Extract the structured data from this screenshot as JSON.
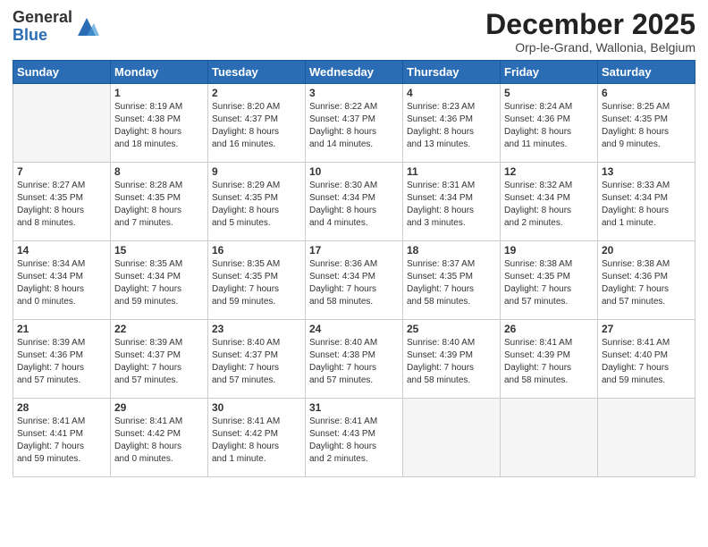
{
  "logo": {
    "general": "General",
    "blue": "Blue"
  },
  "header": {
    "title": "December 2025",
    "subtitle": "Orp-le-Grand, Wallonia, Belgium"
  },
  "weekdays": [
    "Sunday",
    "Monday",
    "Tuesday",
    "Wednesday",
    "Thursday",
    "Friday",
    "Saturday"
  ],
  "weeks": [
    [
      {
        "day": "",
        "info": ""
      },
      {
        "day": "1",
        "info": "Sunrise: 8:19 AM\nSunset: 4:38 PM\nDaylight: 8 hours\nand 18 minutes."
      },
      {
        "day": "2",
        "info": "Sunrise: 8:20 AM\nSunset: 4:37 PM\nDaylight: 8 hours\nand 16 minutes."
      },
      {
        "day": "3",
        "info": "Sunrise: 8:22 AM\nSunset: 4:37 PM\nDaylight: 8 hours\nand 14 minutes."
      },
      {
        "day": "4",
        "info": "Sunrise: 8:23 AM\nSunset: 4:36 PM\nDaylight: 8 hours\nand 13 minutes."
      },
      {
        "day": "5",
        "info": "Sunrise: 8:24 AM\nSunset: 4:36 PM\nDaylight: 8 hours\nand 11 minutes."
      },
      {
        "day": "6",
        "info": "Sunrise: 8:25 AM\nSunset: 4:35 PM\nDaylight: 8 hours\nand 9 minutes."
      }
    ],
    [
      {
        "day": "7",
        "info": "Sunrise: 8:27 AM\nSunset: 4:35 PM\nDaylight: 8 hours\nand 8 minutes."
      },
      {
        "day": "8",
        "info": "Sunrise: 8:28 AM\nSunset: 4:35 PM\nDaylight: 8 hours\nand 7 minutes."
      },
      {
        "day": "9",
        "info": "Sunrise: 8:29 AM\nSunset: 4:35 PM\nDaylight: 8 hours\nand 5 minutes."
      },
      {
        "day": "10",
        "info": "Sunrise: 8:30 AM\nSunset: 4:34 PM\nDaylight: 8 hours\nand 4 minutes."
      },
      {
        "day": "11",
        "info": "Sunrise: 8:31 AM\nSunset: 4:34 PM\nDaylight: 8 hours\nand 3 minutes."
      },
      {
        "day": "12",
        "info": "Sunrise: 8:32 AM\nSunset: 4:34 PM\nDaylight: 8 hours\nand 2 minutes."
      },
      {
        "day": "13",
        "info": "Sunrise: 8:33 AM\nSunset: 4:34 PM\nDaylight: 8 hours\nand 1 minute."
      }
    ],
    [
      {
        "day": "14",
        "info": "Sunrise: 8:34 AM\nSunset: 4:34 PM\nDaylight: 8 hours\nand 0 minutes."
      },
      {
        "day": "15",
        "info": "Sunrise: 8:35 AM\nSunset: 4:34 PM\nDaylight: 7 hours\nand 59 minutes."
      },
      {
        "day": "16",
        "info": "Sunrise: 8:35 AM\nSunset: 4:35 PM\nDaylight: 7 hours\nand 59 minutes."
      },
      {
        "day": "17",
        "info": "Sunrise: 8:36 AM\nSunset: 4:34 PM\nDaylight: 7 hours\nand 58 minutes."
      },
      {
        "day": "18",
        "info": "Sunrise: 8:37 AM\nSunset: 4:35 PM\nDaylight: 7 hours\nand 58 minutes."
      },
      {
        "day": "19",
        "info": "Sunrise: 8:38 AM\nSunset: 4:35 PM\nDaylight: 7 hours\nand 57 minutes."
      },
      {
        "day": "20",
        "info": "Sunrise: 8:38 AM\nSunset: 4:36 PM\nDaylight: 7 hours\nand 57 minutes."
      }
    ],
    [
      {
        "day": "21",
        "info": "Sunrise: 8:39 AM\nSunset: 4:36 PM\nDaylight: 7 hours\nand 57 minutes."
      },
      {
        "day": "22",
        "info": "Sunrise: 8:39 AM\nSunset: 4:37 PM\nDaylight: 7 hours\nand 57 minutes."
      },
      {
        "day": "23",
        "info": "Sunrise: 8:40 AM\nSunset: 4:37 PM\nDaylight: 7 hours\nand 57 minutes."
      },
      {
        "day": "24",
        "info": "Sunrise: 8:40 AM\nSunset: 4:38 PM\nDaylight: 7 hours\nand 57 minutes."
      },
      {
        "day": "25",
        "info": "Sunrise: 8:40 AM\nSunset: 4:39 PM\nDaylight: 7 hours\nand 58 minutes."
      },
      {
        "day": "26",
        "info": "Sunrise: 8:41 AM\nSunset: 4:39 PM\nDaylight: 7 hours\nand 58 minutes."
      },
      {
        "day": "27",
        "info": "Sunrise: 8:41 AM\nSunset: 4:40 PM\nDaylight: 7 hours\nand 59 minutes."
      }
    ],
    [
      {
        "day": "28",
        "info": "Sunrise: 8:41 AM\nSunset: 4:41 PM\nDaylight: 7 hours\nand 59 minutes."
      },
      {
        "day": "29",
        "info": "Sunrise: 8:41 AM\nSunset: 4:42 PM\nDaylight: 8 hours\nand 0 minutes."
      },
      {
        "day": "30",
        "info": "Sunrise: 8:41 AM\nSunset: 4:42 PM\nDaylight: 8 hours\nand 1 minute."
      },
      {
        "day": "31",
        "info": "Sunrise: 8:41 AM\nSunset: 4:43 PM\nDaylight: 8 hours\nand 2 minutes."
      },
      {
        "day": "",
        "info": ""
      },
      {
        "day": "",
        "info": ""
      },
      {
        "day": "",
        "info": ""
      }
    ]
  ]
}
